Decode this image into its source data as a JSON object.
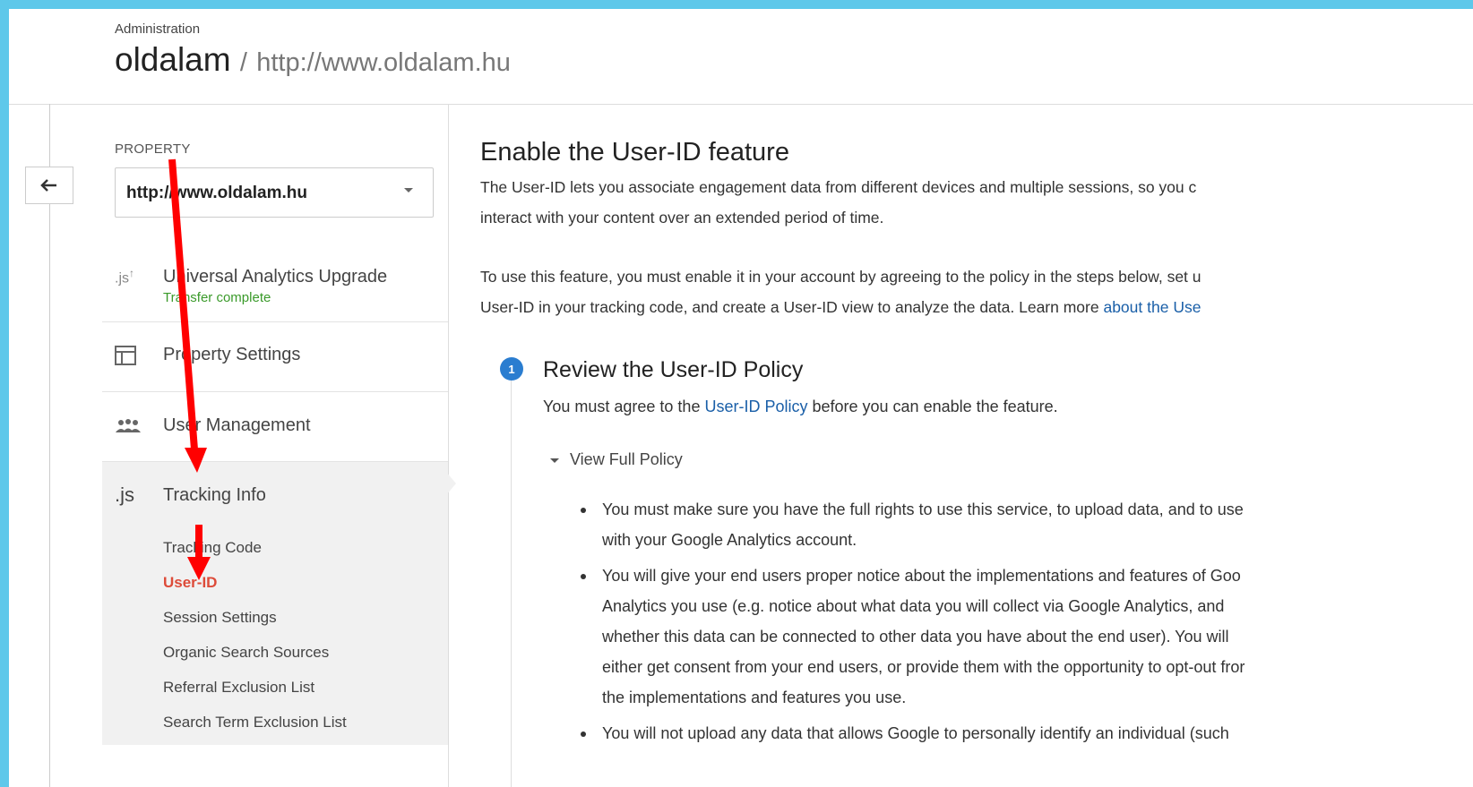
{
  "header": {
    "admin_label": "Administration",
    "account": "oldalam",
    "separator": "/",
    "url": "http://www.oldalam.hu"
  },
  "sidebar": {
    "back_icon": "back-arrow-icon",
    "property_label": "PROPERTY",
    "property_value": "http://www.oldalam.hu",
    "items": [
      {
        "label": "Universal Analytics Upgrade",
        "sub": "Transfer complete",
        "icon": "js-upgrade-icon"
      },
      {
        "label": "Property Settings",
        "icon": "layout-icon"
      },
      {
        "label": "User Management",
        "icon": "users-icon"
      },
      {
        "label": "Tracking Info",
        "icon": "js-icon"
      }
    ],
    "tracking_subitems": [
      "Tracking Code",
      "User-ID",
      "Session Settings",
      "Organic Search Sources",
      "Referral Exclusion List",
      "Search Term Exclusion List"
    ],
    "active_subitem": "User-ID"
  },
  "main": {
    "title": "Enable the User-ID feature",
    "intro_line1": "The User-ID lets you associate engagement data from different devices and multiple sessions, so you c",
    "intro_line2": "interact with your content over an extended period of time.",
    "use_line1": "To use this feature, you must enable it in your account by agreeing to the policy in the steps below, set u",
    "use_line2_pre": "User-ID in your tracking code, and create a User-ID view to analyze the data. Learn more ",
    "use_line2_link": "about the Use",
    "step": {
      "number": "1",
      "title": "Review the User-ID Policy",
      "text_pre": "You must agree to the ",
      "text_link": "User-ID Policy",
      "text_post": " before you can enable the feature.",
      "toggle": "View Full Policy"
    },
    "policy_bullets": [
      [
        "You must make sure you have the full rights to use this service, to upload data, and to use",
        "with your Google Analytics account."
      ],
      [
        "You will give your end users proper notice about the implementations and features of Goo",
        "Analytics you use (e.g. notice about what data you will collect via Google Analytics, and",
        "whether this data can be connected to other data you have about the end user). You will",
        "either get consent from your end users, or provide them with the opportunity to opt-out fror",
        "the implementations and features you use."
      ],
      [
        "You will not upload any data that allows Google to personally identify an individual (such"
      ]
    ]
  },
  "colors": {
    "background": "#5ec8ea",
    "active": "#dd4b39",
    "link": "#1a5fa8",
    "success": "#3a9a2a",
    "step_badge": "#2a7dd0",
    "annotation_arrow": "#ff0000"
  }
}
